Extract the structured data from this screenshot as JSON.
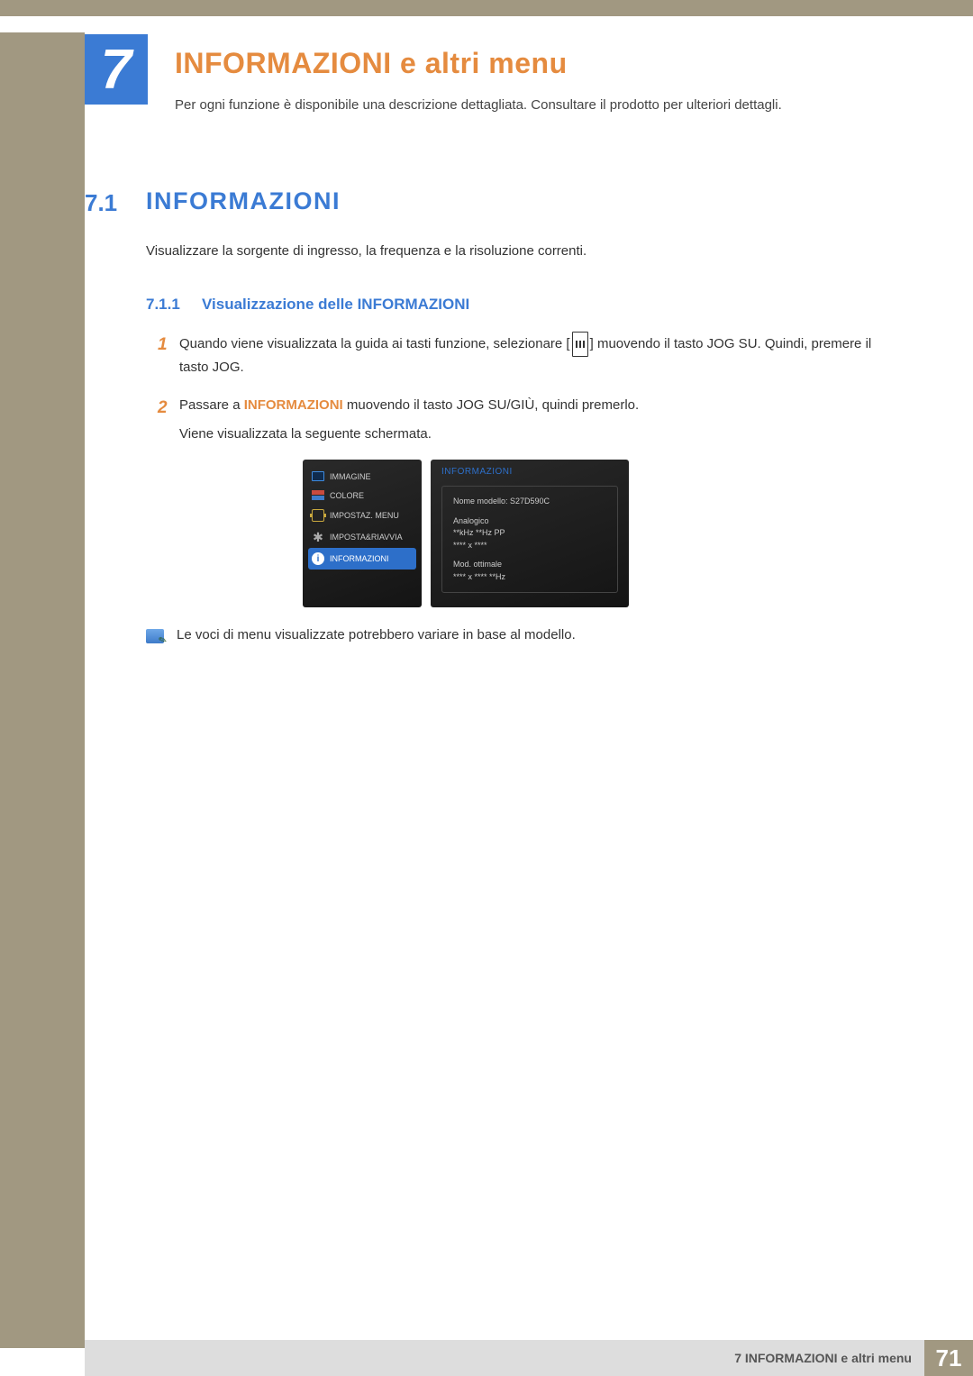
{
  "chapter": {
    "number": "7",
    "title": "INFORMAZIONI e altri menu",
    "description": "Per ogni funzione è disponibile una descrizione dettagliata. Consultare il prodotto per ulteriori dettagli."
  },
  "section": {
    "number": "7.1",
    "title": "INFORMAZIONI",
    "description": "Visualizzare la sorgente di ingresso, la frequenza e la risoluzione correnti."
  },
  "subsection": {
    "number": "7.1.1",
    "title": "Visualizzazione delle INFORMAZIONI"
  },
  "steps": [
    {
      "num": "1",
      "pre": "Quando viene visualizzata la guida ai tasti funzione, selezionare [",
      "post": "] muovendo il tasto JOG SU. Quindi, premere il tasto JOG."
    },
    {
      "num": "2",
      "pre": "Passare a ",
      "bold": "INFORMAZIONI",
      "post": " muovendo il tasto JOG SU/GIÙ, quindi premerlo.",
      "extra": "Viene visualizzata la seguente schermata."
    }
  ],
  "osd": {
    "menu_items": [
      {
        "label": "IMMAGINE"
      },
      {
        "label": "COLORE"
      },
      {
        "label": "IMPOSTAZ. MENU"
      },
      {
        "label": "IMPOSTA&RIAVVIA"
      },
      {
        "label": "INFORMAZIONI",
        "selected": true
      }
    ],
    "panel_title": "INFORMAZIONI",
    "model_line": "Nome modello: S27D590C",
    "analog": "Analogico",
    "freq": "**kHz **Hz PP",
    "res": "**** x ****",
    "optimal_label": "Mod. ottimale",
    "optimal_value": "**** x **** **Hz"
  },
  "note": "Le voci di menu visualizzate potrebbero variare in base al modello.",
  "footer": {
    "text": "7 INFORMAZIONI e altri menu",
    "page": "71"
  }
}
